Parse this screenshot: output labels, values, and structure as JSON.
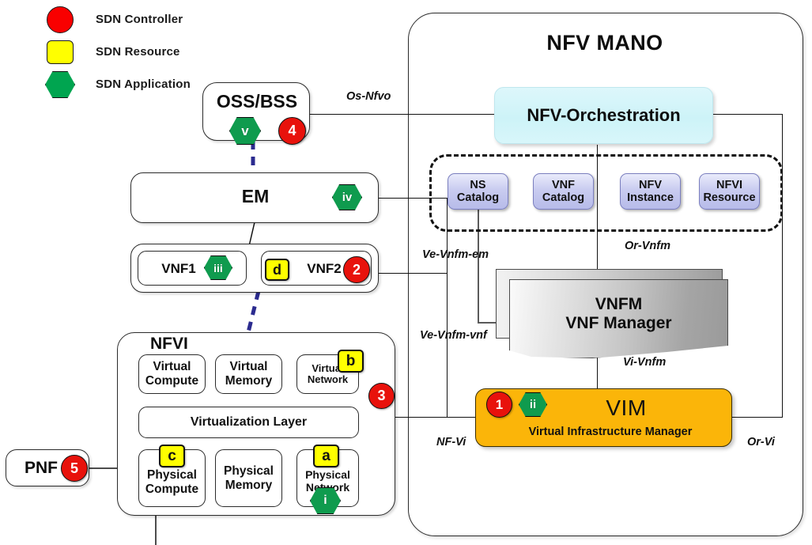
{
  "legend": {
    "items": [
      {
        "shape": "circle",
        "color": "#f90000",
        "label": "SDN Controller"
      },
      {
        "shape": "square",
        "color": "#ffff00",
        "label": "SDN Resource"
      },
      {
        "shape": "hexagon",
        "color": "#00a550",
        "label": "SDN Application"
      }
    ]
  },
  "left": {
    "oss": {
      "title": "OSS/BSS",
      "app_badge": "v",
      "ctrl_badge": "4"
    },
    "em": {
      "title": "EM",
      "app_badge": "iv"
    },
    "vnf1": {
      "title": "VNF1",
      "app_badge": "iii"
    },
    "vnf2": {
      "title": "VNF2",
      "res_badge": "d",
      "ctrl_badge": "2"
    },
    "pnf": {
      "title": "PNF",
      "ctrl_badge": "5"
    },
    "nfvi": {
      "title": "NFVI",
      "ctrl_badge": "3",
      "virtualization_layer": "Virtualization Layer",
      "virtual": [
        {
          "line1": "Virtual",
          "line2": "Compute"
        },
        {
          "line1": "Virtual",
          "line2": "Memory"
        },
        {
          "line1": "Virtual",
          "line2": "Network",
          "res_badge": "b"
        }
      ],
      "physical": [
        {
          "line1": "Physical",
          "line2": "Compute",
          "res_badge": "c"
        },
        {
          "line1": "Physical",
          "line2": "Memory"
        },
        {
          "line1": "Physical",
          "line2": "Network",
          "res_badge": "a",
          "app_badge": "i"
        }
      ]
    }
  },
  "mano": {
    "title": "NFV MANO",
    "orchestrator": "NFV-Orchestration",
    "repositories": [
      {
        "line1": "NS",
        "line2": "Catalog"
      },
      {
        "line1": "VNF",
        "line2": "Catalog"
      },
      {
        "line1": "NFV",
        "line2": "Instance"
      },
      {
        "line1": "NFVI",
        "line2": "Resource"
      }
    ],
    "vnfm": {
      "line1": "VNFM",
      "line2": "VNF Manager"
    },
    "vim": {
      "title": "VIM",
      "subtitle": "Virtual Infrastructure Manager",
      "ctrl_badge": "1",
      "app_badge": "ii"
    }
  },
  "interfaces": {
    "os_nfvo": "Os-Nfvo",
    "ve_vnfm_em": "Ve-Vnfm-em",
    "ve_vnfm_vnf": "Ve-Vnfm-vnf",
    "or_vnfm": "Or-Vnfm",
    "vi_vnfm": "Vi-Vnfm",
    "nf_vi": "NF-Vi",
    "or_vi": "Or-Vi"
  },
  "colors": {
    "sdn_controller": "#e8120c",
    "sdn_resource": "#ffff00",
    "sdn_application": "#0f9b4e",
    "vim_orange": "#fbb509",
    "nfvo_cyan": "#cdf3f8",
    "repo_lavender": "#c9ccf0",
    "sdn_link_blue": "#2b2b8f"
  }
}
